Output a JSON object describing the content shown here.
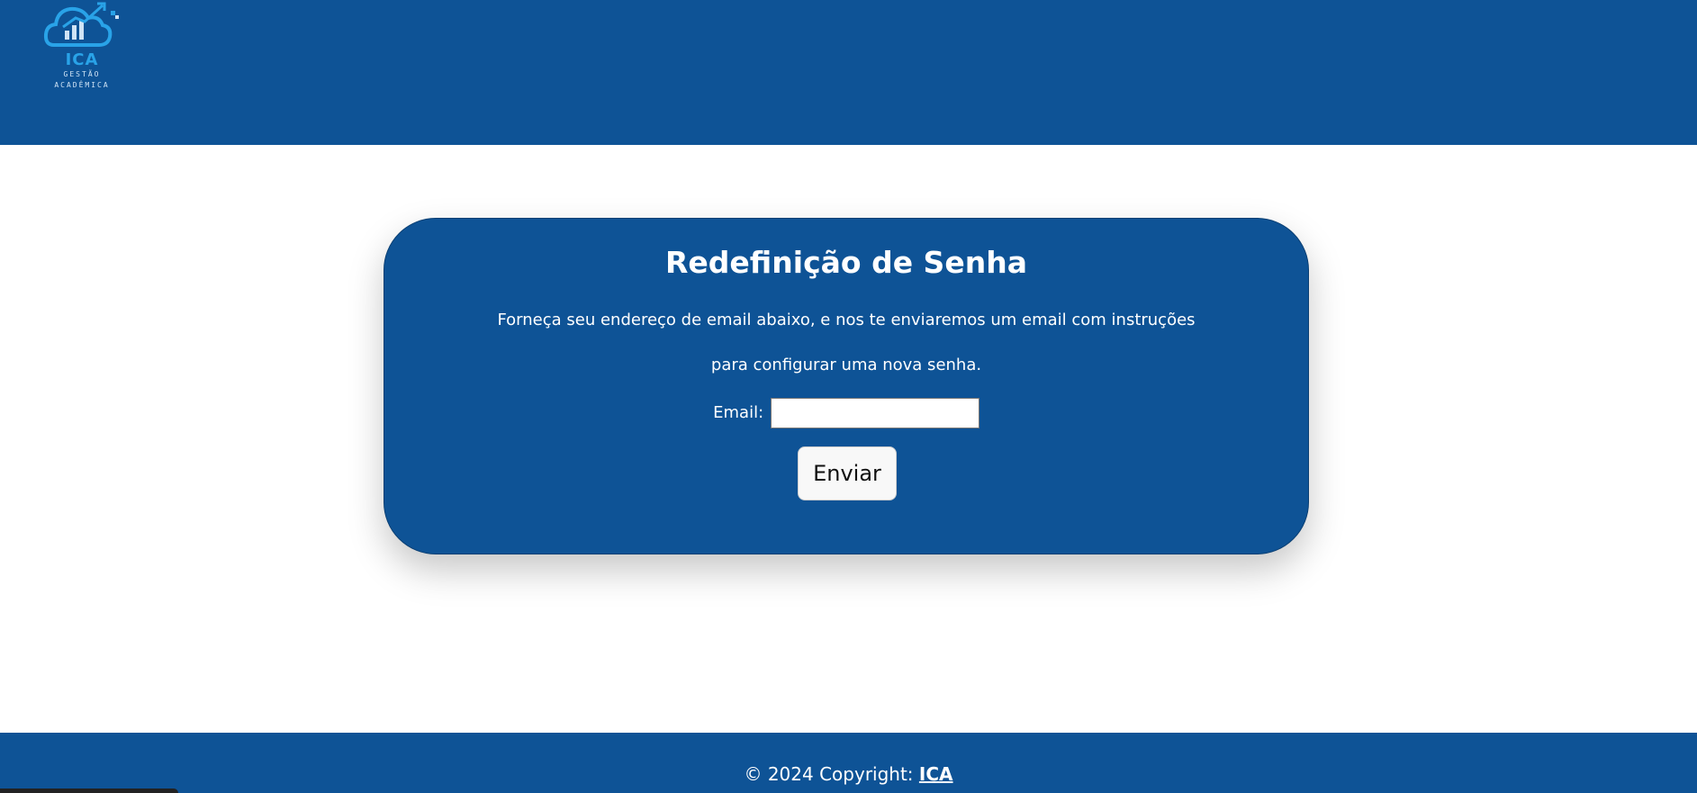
{
  "header": {
    "logo": {
      "name": "ICA",
      "subtitle_line1": "GESTÃO",
      "subtitle_line2": "ACADÊMICA",
      "icon": "cloud-chart-icon"
    }
  },
  "card": {
    "title": "Redefinição de Senha",
    "text_line1": "Forneça seu endereço de email abaixo, e nos te enviaremos um email com instruções",
    "text_line2": "para configurar uma nova senha.",
    "email_label": "Email:",
    "email_value": "",
    "submit_label": "Enviar"
  },
  "footer": {
    "copyright_prefix": "© 2024 Copyright:",
    "copyright_link": "ICA"
  },
  "colors": {
    "primary": "#0e5396",
    "accent": "#29a3e8",
    "background": "#ffffff",
    "button_bg": "#f8f8f8"
  }
}
